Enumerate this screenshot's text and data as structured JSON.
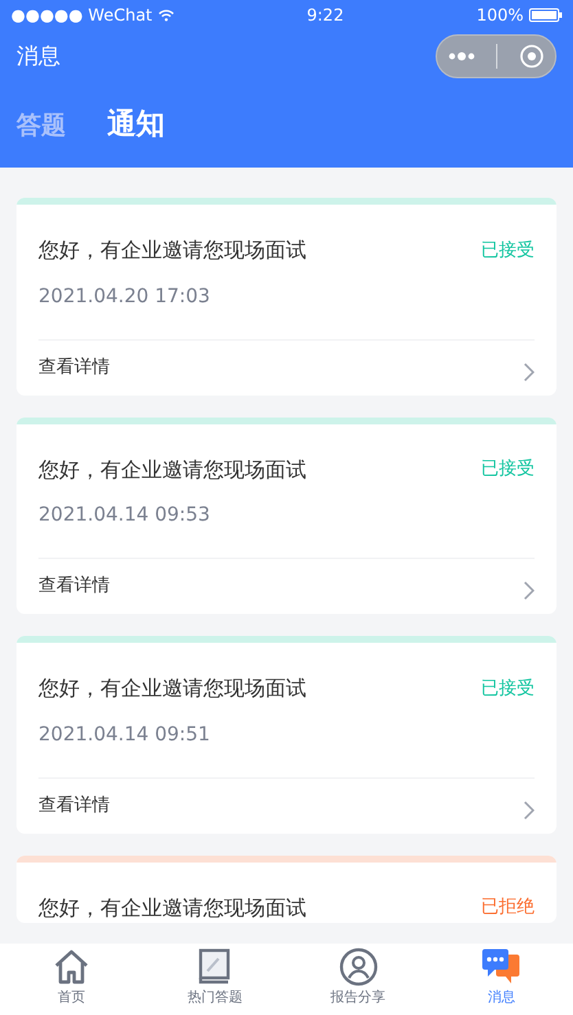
{
  "status_bar": {
    "carrier": "●●●●● WeChat",
    "time": "9:22",
    "battery": "100%"
  },
  "nav_bar": {
    "title": "消息"
  },
  "tabs": [
    {
      "label": "答题",
      "selected": false
    },
    {
      "label": "通知",
      "selected": true
    }
  ],
  "notifications": [
    {
      "title": "您好，有企业邀请您现场面试",
      "status": "已接受",
      "kind": "accepted",
      "date": "2021.04.20 17:03",
      "link": "查看详情"
    },
    {
      "title": "您好，有企业邀请您现场面试",
      "status": "已接受",
      "kind": "accepted",
      "date": "2021.04.14 09:53",
      "link": "查看详情"
    },
    {
      "title": "您好，有企业邀请您现场面试",
      "status": "已接受",
      "kind": "accepted",
      "date": "2021.04.14 09:51",
      "link": "查看详情"
    },
    {
      "title": "您好，有企业邀请您现场面试",
      "status": "已拒绝",
      "kind": "rejected"
    }
  ],
  "tab_bar": [
    {
      "label": "首页",
      "kind": "home",
      "selected": false
    },
    {
      "label": "热门答题",
      "kind": "book",
      "selected": false
    },
    {
      "label": "报告分享",
      "kind": "person",
      "selected": false
    },
    {
      "label": "消息",
      "kind": "chat",
      "selected": true
    }
  ]
}
